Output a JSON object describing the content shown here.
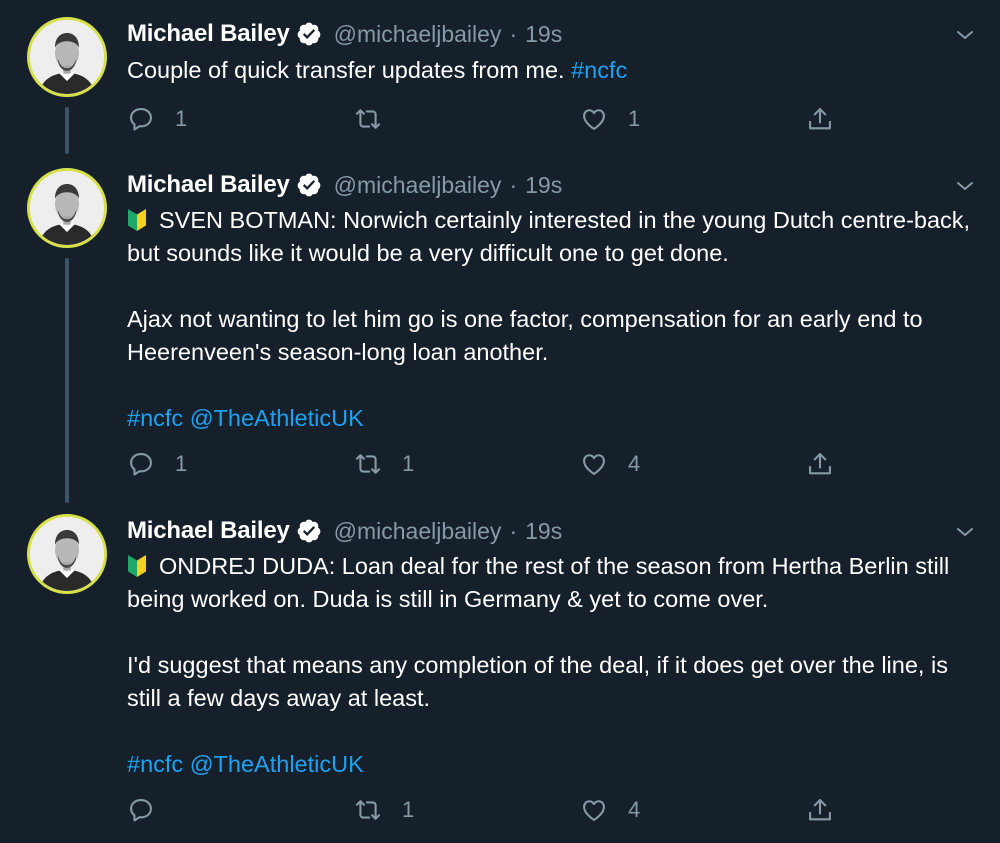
{
  "tweets": [
    {
      "author": {
        "name": "Michael Bailey",
        "handle": "@michaeljbailey",
        "time": "19s",
        "verified": true
      },
      "lines": [
        {
          "type": "text",
          "parts": [
            "Couple of quick transfer updates from me. "
          ],
          "link": "#ncfc"
        }
      ],
      "actions": {
        "replies": "1",
        "retweets": "",
        "likes": "1"
      }
    },
    {
      "author": {
        "name": "Michael Bailey",
        "handle": "@michaeljbailey",
        "time": "19s",
        "verified": true
      },
      "body": {
        "p1": "SVEN BOTMAN: Norwich certainly interested in the young Dutch centre-back, but sounds like it would be a very difficult one to get done.",
        "p2": "Ajax not wanting to let him go is one factor, compensation for an early end to Heerenveen's season-long loan another.",
        "tags": "#ncfc @TheAthleticUK"
      },
      "actions": {
        "replies": "1",
        "retweets": "1",
        "likes": "4"
      }
    },
    {
      "author": {
        "name": "Michael Bailey",
        "handle": "@michaeljbailey",
        "time": "19s",
        "verified": true
      },
      "body": {
        "p1": "ONDREJ DUDA: Loan deal for the rest of the season from Hertha Berlin still being worked on. Duda is still in Germany & yet to come over.",
        "p2": "I'd suggest that means any completion of the deal, if it does get over the line, is still a few days away at least.",
        "tags": "#ncfc @TheAthleticUK"
      },
      "actions": {
        "replies": "",
        "retweets": "1",
        "likes": "4"
      }
    }
  ],
  "tweet1_text": "Couple of quick transfer updates from me.",
  "tweet1_tag": "#ncfc",
  "icons": [
    "verified-badge-icon",
    "chevron-down-icon",
    "reply-icon",
    "retweet-icon",
    "like-icon",
    "share-icon",
    "beginner-flag-icon"
  ],
  "colors": {
    "background": "#15202b",
    "secondary_text": "#8899a6",
    "link": "#1da1f2",
    "thread_line": "#3d5466",
    "avatar_ring": "#d6e14a"
  }
}
